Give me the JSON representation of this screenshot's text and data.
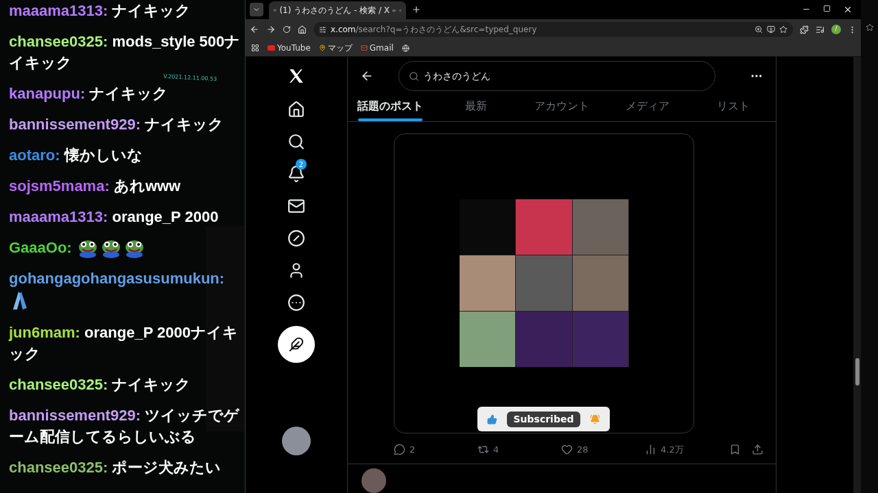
{
  "chat": {
    "version_label": "V.2021.12.11.00.53",
    "messages": [
      {
        "user": "maaama1313:",
        "color": "#b57bff",
        "text": "ナイキック"
      },
      {
        "user": "chansee0325:",
        "color": "#a8f07a",
        "text": "mods_style 500ナイキック"
      },
      {
        "user": "kanapupu:",
        "color": "#b57bff",
        "text": "ナイキック"
      },
      {
        "user": "bannissement929:",
        "color": "#c59cf5",
        "text": "ナイキック"
      },
      {
        "user": "aotaro:",
        "color": "#3b8ee8",
        "text": "懐かしいな"
      },
      {
        "user": "sojsm5mama:",
        "color": "#b868f5",
        "text": "あれwww"
      },
      {
        "user": "maaama1313:",
        "color": "#b57bff",
        "text": "orange_P 2000"
      },
      {
        "user": "GaaaOo:",
        "color": "#4fd33a",
        "emotes": [
          {
            "kind": "frog"
          },
          {
            "kind": "frog"
          },
          {
            "kind": "frog"
          }
        ]
      },
      {
        "user": "gohangagohangasusumukun:",
        "color": "#5f9fe8",
        "emotes": [
          {
            "kind": "hands"
          }
        ]
      },
      {
        "user": "jun6mam:",
        "color": "#a8e040",
        "text": "orange_P 2000ナイキック"
      },
      {
        "user": "chansee0325:",
        "color": "#a8f07a",
        "text": "ナイキック"
      },
      {
        "user": "bannissement929:",
        "color": "#c59cf5",
        "text": "ツイッチでゲーム配信してるらしいぶる"
      },
      {
        "user": "chansee0325:",
        "color": "#8fbf6a",
        "text": "ポージ犬みたい"
      }
    ]
  },
  "browser": {
    "tab": {
      "title": "(1) うわさのうどん - 検索 / X"
    },
    "url_host": "x.com",
    "url_path": "/search?q=うわさのうどん&src=typed_query",
    "bookmarks": [
      "YouTube",
      "マップ",
      "Gmail"
    ],
    "profile_initial": "/"
  },
  "x": {
    "notification_badge": "2",
    "search": {
      "value": "うわさのうどん"
    },
    "tabs": [
      {
        "label": "話題のポスト",
        "selected": true
      },
      {
        "label": "最新",
        "selected": false
      },
      {
        "label": "アカウント",
        "selected": false
      },
      {
        "label": "メディア",
        "selected": false
      },
      {
        "label": "リスト",
        "selected": false
      }
    ],
    "overlay": {
      "label": "Subscribed"
    },
    "stats": [
      {
        "kind": "reply",
        "value": "2"
      },
      {
        "kind": "repost",
        "value": "4"
      },
      {
        "kind": "like",
        "value": "28"
      },
      {
        "kind": "views",
        "value": "4.2万"
      }
    ]
  }
}
